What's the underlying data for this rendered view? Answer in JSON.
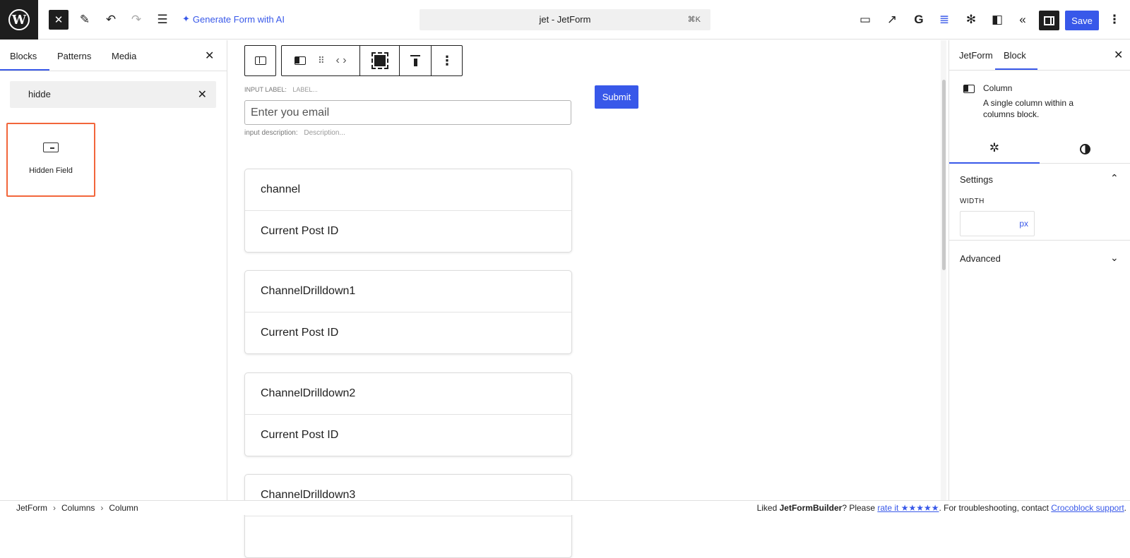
{
  "toolbar": {
    "generate_ai": "Generate Form with AI",
    "command_title": "jet - JetForm",
    "command_shortcut": "⌘K",
    "save": "Save"
  },
  "inserter": {
    "tabs": [
      "Blocks",
      "Patterns",
      "Media"
    ],
    "search_value": "hidde",
    "results": [
      {
        "label": "Hidden Field",
        "icon": "hidden-field-icon"
      }
    ]
  },
  "canvas": {
    "input_label_caption": "INPUT LABEL:",
    "input_label_placeholder": "LABEL...",
    "email_placeholder": "Enter you email",
    "input_desc_caption": "input description:",
    "input_desc_placeholder": "Description...",
    "submit": "Submit",
    "fields": [
      {
        "name": "channel",
        "value": "Current Post ID"
      },
      {
        "name": "ChannelDrilldown1",
        "value": "Current Post ID"
      },
      {
        "name": "ChannelDrilldown2",
        "value": "Current Post ID"
      },
      {
        "name": "ChannelDrilldown3",
        "value": ""
      }
    ]
  },
  "settings_panel": {
    "tabs": [
      "JetForm",
      "Block"
    ],
    "block_title": "Column",
    "block_desc": "A single column within a columns block.",
    "settings_heading": "Settings",
    "width_label": "WIDTH",
    "width_value": "",
    "width_unit": "px",
    "advanced_heading": "Advanced"
  },
  "footer": {
    "breadcrumbs": [
      "JetForm",
      "Columns",
      "Column"
    ],
    "note_prefix": "Liked ",
    "note_brand": "JetFormBuilder",
    "note_mid": "? Please ",
    "note_rate": "rate it ★★★★★",
    "note_suffix": ". For troubleshooting, contact ",
    "note_support": "Crocoblock support",
    "note_end": "."
  },
  "colors": {
    "accent": "#3858e9",
    "highlight": "#f2663b",
    "dark": "#1e1e1e"
  }
}
